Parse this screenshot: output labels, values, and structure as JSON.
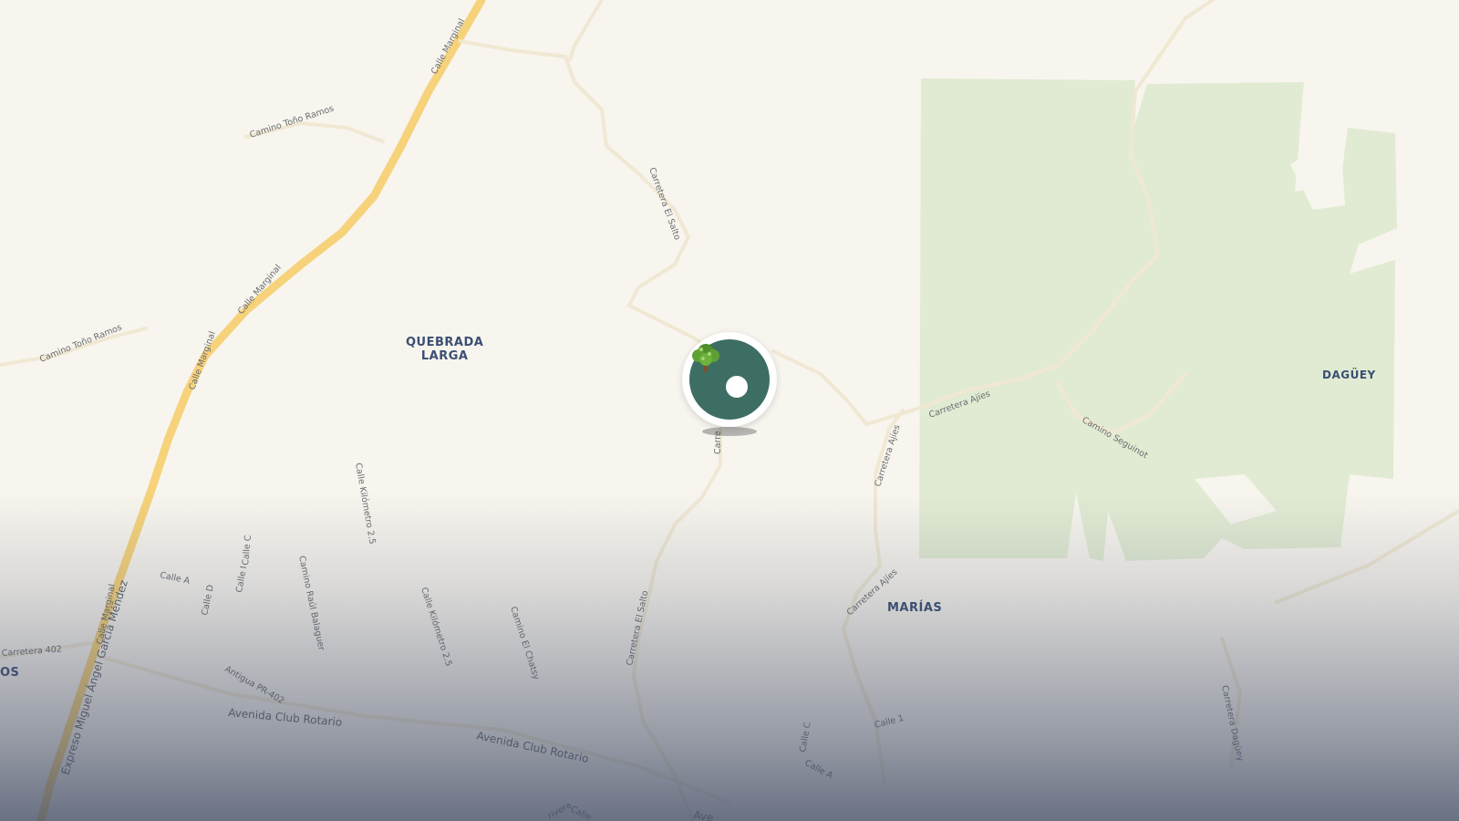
{
  "colors": {
    "land": "#f8f5ee",
    "park": "#e1ebd3",
    "highway": "#f9d97a",
    "road": "#f3ecd9",
    "marker": "#3d6e63",
    "place_text": "#3a4f73"
  },
  "places": {
    "quebrada_larga": "QUEBRADA\nLARGA",
    "daguey": "DAGÜEY",
    "marias": "MARÍAS",
    "os": "OS"
  },
  "streets": {
    "calle_marginal_top": "Calle Marginal",
    "camino_tono_ramos_1": "Camino Toño Ramos",
    "camino_tono_ramos_2": "Camino Toño Ramos",
    "calle_marginal_mid": "Calle Marginal",
    "calle_marginal_low": "Calle Marginal",
    "carretera_el_salto_top": "Carretera El Salto",
    "carretera_el_salto_mid": "Carre",
    "carretera_el_salto_low": "Carretera El Salto",
    "carretera_ajies_1": "Carretera Ajíes",
    "carretera_ajies_2": "Carretera Ajíes",
    "carretera_ajies_3": "Carretera Ajíes",
    "camino_seguinot": "Camino Seguinot",
    "calle_kilometro_25_a": "Calle Kilómetro 2.5",
    "calle_kilometro_25_b": "Calle Kilómetro 2.5",
    "calle_c_1": "Calle C",
    "calle_i": "Calle I",
    "calle_a_1": "Calle A",
    "calle_d": "Calle D",
    "camino_raul_balaguer": "Camino Raúl Balaguer",
    "camino_el_chatsy": "Camino El Chatsy",
    "calle_marginal_sw": "Calle Marginal",
    "carretera_402": "Carretera 402",
    "expreso": "Expreso Miguel Ángel García Méndez",
    "antigua_pr_402": "Antigua PR-402",
    "avenida_club_rotario_1": "Avenida Club Rotario",
    "avenida_club_rotario_2": "Avenida Club Rotario",
    "calle_c_2": "Calle C",
    "calle_a_2": "Calle A",
    "calle_1": "Calle 1",
    "carretera_daguey": "Carretera Dagüey",
    "bottom_fragment_1": "Ave",
    "bottom_fragment_2": "Calle",
    "bottom_fragment_3": "rivera"
  },
  "marker": {
    "icon": "tree-icon"
  }
}
